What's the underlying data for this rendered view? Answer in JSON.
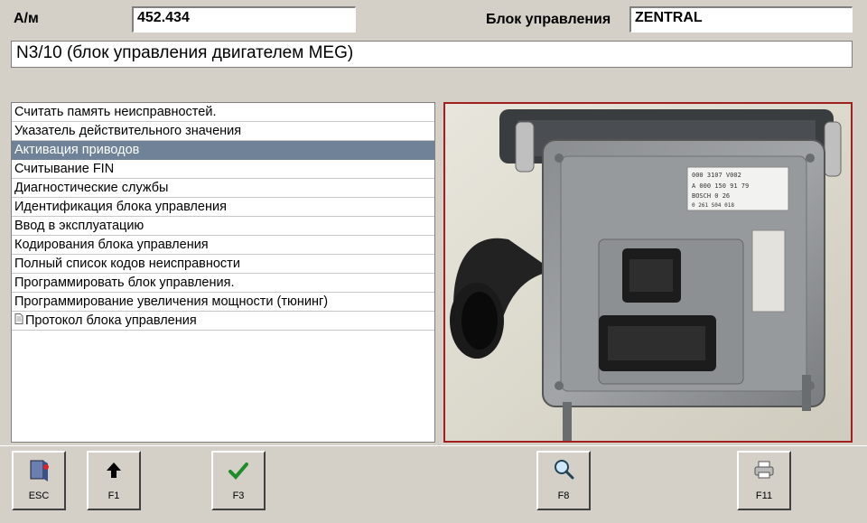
{
  "header": {
    "am_label": "А/м",
    "am_value": "452.434",
    "unit_label": "Блок управления",
    "unit_value": "ZENTRAL"
  },
  "description": "N3/10 (блок управления двигателем MEG)",
  "menu": {
    "selected_index": 2,
    "items": [
      {
        "label": "Считать память неисправностей."
      },
      {
        "label": "Указатель действительного значения"
      },
      {
        "label": "Активация приводов"
      },
      {
        "label": "Считывание FIN"
      },
      {
        "label": "Диагностические службы"
      },
      {
        "label": "Идентификация блока управления"
      },
      {
        "label": "Ввод в эксплуатацию"
      },
      {
        "label": "Кодирования блока управления"
      },
      {
        "label": "Полный список кодов неисправности"
      },
      {
        "label": "Программировать блок управления."
      },
      {
        "label": "Программирование увеличения мощности (тюнинг)"
      },
      {
        "label": "Протокол блока управления",
        "icon": "document-icon"
      }
    ]
  },
  "photo": {
    "label_lines": [
      "000 3107 V002",
      "A 000 150 91 79",
      "BOSCH  0 26",
      "0 261 S04 018"
    ]
  },
  "buttons": {
    "esc": {
      "label": "ESC",
      "icon": "exit-door-icon"
    },
    "f1": {
      "label": "F1",
      "icon": "arrow-up-icon"
    },
    "f3": {
      "label": "F3",
      "icon": "checkmark-icon"
    },
    "f8": {
      "label": "F8",
      "icon": "magnifier-icon"
    },
    "f11": {
      "label": "F11",
      "icon": "printer-icon"
    }
  },
  "colors": {
    "window_bg": "#d4d0c8",
    "selection": "#6f8297",
    "photo_border": "#a02020",
    "check_green": "#1e8c2a"
  }
}
